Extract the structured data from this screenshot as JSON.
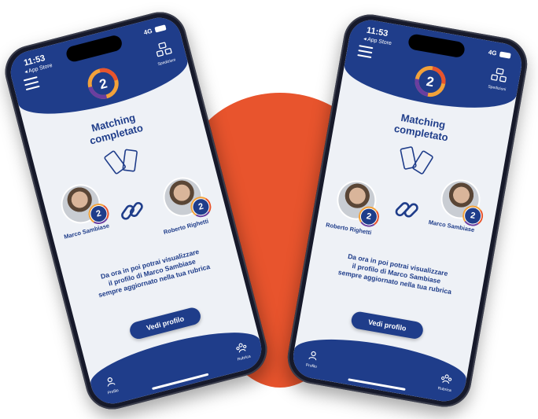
{
  "phones": [
    {
      "time": "11:53",
      "back_label": "◂ App Store",
      "network": "4G",
      "spedizioni_label": "Spedizioni",
      "title_line1": "Matching",
      "title_line2": "completato",
      "person_a": "Marco Sambiase",
      "person_b": "Roberto Righetti",
      "message_line1": "Da ora in poi potrai visualizzare",
      "message_line2": "il profilo di Marco Sambiase",
      "message_line3": "sempre aggiornato nella tua rubrica",
      "cta_label": "Vedi profilo",
      "nav_profile": "Profilo",
      "nav_rubrica": "Rubrica",
      "badge_label": "2"
    },
    {
      "time": "11:53",
      "back_label": "◂ App Store",
      "network": "4G",
      "spedizioni_label": "Spedizioni",
      "title_line1": "Matching",
      "title_line2": "completato",
      "person_a": "Roberto Righetti",
      "person_b": "Marco Sambiase",
      "message_line1": "Da ora in poi potrai visualizzare",
      "message_line2": "il profilo di Marco Sambiase",
      "message_line3": "sempre aggiornato nella tua rubrica",
      "cta_label": "Vedi profilo",
      "nav_profile": "Profilo",
      "nav_rubrica": "Rubrica",
      "badge_label": "2"
    }
  ],
  "colors": {
    "brand_blue": "#1f3d8a",
    "accent_orange": "#e8542d",
    "screen_bg": "#eef1f6"
  },
  "icons": [
    "menu-icon",
    "spedizioni-icon",
    "app-logo-icon",
    "phones-match-icon",
    "link-chain-icon",
    "profile-icon",
    "rubrica-icon"
  ]
}
